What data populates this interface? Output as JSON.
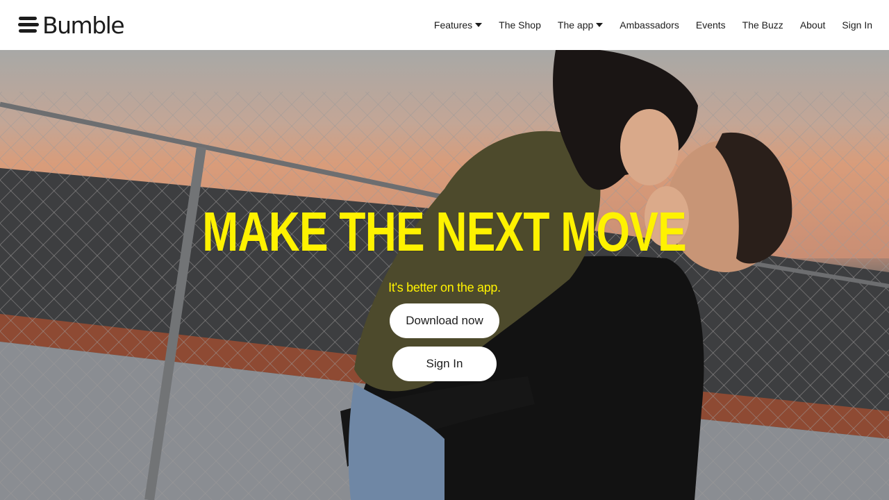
{
  "brand": {
    "name": "Bumble"
  },
  "nav": {
    "items": [
      {
        "label": "Features",
        "dropdown": true
      },
      {
        "label": "The Shop",
        "dropdown": false
      },
      {
        "label": "The app",
        "dropdown": true
      },
      {
        "label": "Ambassadors",
        "dropdown": false
      },
      {
        "label": "Events",
        "dropdown": false
      },
      {
        "label": "The Buzz",
        "dropdown": false
      },
      {
        "label": "About",
        "dropdown": false
      },
      {
        "label": "Sign In",
        "dropdown": false
      }
    ]
  },
  "hero": {
    "headline": "MAKE THE NEXT MOVE",
    "subline": "It's better on the app.",
    "primary_button": "Download now",
    "secondary_button": "Sign In"
  },
  "colors": {
    "accent_yellow": "#fff200",
    "header_bg": "#ffffff",
    "text_dark": "#1c1c1c",
    "button_bg": "#ffffff"
  },
  "icons": {
    "logo_mark": "bumble-stripes-icon",
    "dropdown": "caret-down-icon"
  }
}
